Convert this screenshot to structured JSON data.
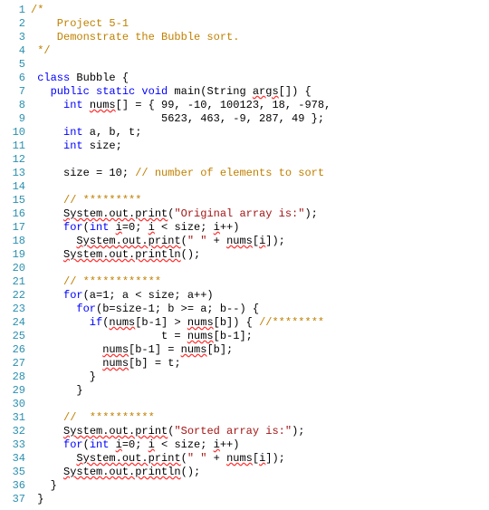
{
  "lines": [
    {
      "n": 1,
      "tokens": [
        [
          "c-orange",
          "/*",
          false
        ]
      ]
    },
    {
      "n": 2,
      "tokens": [
        [
          "c-orange",
          "    Project 5-1",
          false
        ]
      ]
    },
    {
      "n": 3,
      "tokens": [
        [
          "c-orange",
          "    Demonstrate the Bubble sort.",
          false
        ]
      ]
    },
    {
      "n": 4,
      "tokens": [
        [
          "c-orange",
          " */",
          false
        ]
      ]
    },
    {
      "n": 5,
      "tokens": [
        [
          "c-black",
          "",
          false
        ]
      ]
    },
    {
      "n": 6,
      "tokens": [
        [
          "c-blue",
          " class",
          false
        ],
        [
          "c-black",
          " Bubble {",
          false
        ]
      ]
    },
    {
      "n": 7,
      "tokens": [
        [
          "c-blue",
          "   public static void",
          false
        ],
        [
          "c-black",
          " main(String ",
          false
        ],
        [
          "c-black",
          "args",
          true
        ],
        [
          "c-black",
          "[]) {",
          false
        ]
      ]
    },
    {
      "n": 8,
      "tokens": [
        [
          "c-blue",
          "     int",
          false
        ],
        [
          "c-black",
          " ",
          false
        ],
        [
          "c-black",
          "nums",
          true
        ],
        [
          "c-black",
          "[] = { 99, -10, 100123, 18, -978,",
          false
        ]
      ]
    },
    {
      "n": 9,
      "tokens": [
        [
          "c-black",
          "                    5623, 463, -9, 287, 49 };",
          false
        ]
      ]
    },
    {
      "n": 10,
      "tokens": [
        [
          "c-blue",
          "     int",
          false
        ],
        [
          "c-black",
          " a, b, t;",
          false
        ]
      ]
    },
    {
      "n": 11,
      "tokens": [
        [
          "c-blue",
          "     int",
          false
        ],
        [
          "c-black",
          " size;",
          false
        ]
      ]
    },
    {
      "n": 12,
      "tokens": [
        [
          "c-black",
          "",
          false
        ]
      ]
    },
    {
      "n": 13,
      "tokens": [
        [
          "c-black",
          "     size = 10; ",
          false
        ],
        [
          "c-orange",
          "// number of elements to sort",
          false
        ]
      ]
    },
    {
      "n": 14,
      "tokens": [
        [
          "c-black",
          "",
          false
        ]
      ]
    },
    {
      "n": 15,
      "tokens": [
        [
          "c-black",
          "     ",
          false
        ],
        [
          "c-orange",
          "// *********",
          false
        ]
      ]
    },
    {
      "n": 16,
      "tokens": [
        [
          "c-black",
          "     ",
          false
        ],
        [
          "c-black",
          "System.out.print",
          true
        ],
        [
          "c-black",
          "(",
          false
        ],
        [
          "c-red",
          "\"Original array is:\"",
          false
        ],
        [
          "c-black",
          ");",
          false
        ]
      ]
    },
    {
      "n": 17,
      "tokens": [
        [
          "c-blue",
          "     for",
          false
        ],
        [
          "c-black",
          "(",
          false
        ],
        [
          "c-blue",
          "int",
          false
        ],
        [
          "c-black",
          " ",
          false
        ],
        [
          "c-black",
          "i",
          true
        ],
        [
          "c-black",
          "=0; ",
          false
        ],
        [
          "c-black",
          "i",
          true
        ],
        [
          "c-black",
          " < size; ",
          false
        ],
        [
          "c-black",
          "i",
          true
        ],
        [
          "c-black",
          "++)",
          false
        ]
      ]
    },
    {
      "n": 18,
      "tokens": [
        [
          "c-black",
          "       ",
          false
        ],
        [
          "c-black",
          "System.out.print",
          true
        ],
        [
          "c-black",
          "(",
          false
        ],
        [
          "c-red",
          "\" \"",
          false
        ],
        [
          "c-black",
          " + ",
          false
        ],
        [
          "c-black",
          "nums",
          true
        ],
        [
          "c-black",
          "[",
          false
        ],
        [
          "c-black",
          "i",
          true
        ],
        [
          "c-black",
          "]);",
          false
        ]
      ]
    },
    {
      "n": 19,
      "tokens": [
        [
          "c-black",
          "     ",
          false
        ],
        [
          "c-black",
          "System.out.println",
          true
        ],
        [
          "c-black",
          "();",
          false
        ]
      ]
    },
    {
      "n": 20,
      "tokens": [
        [
          "c-black",
          "",
          false
        ]
      ]
    },
    {
      "n": 21,
      "tokens": [
        [
          "c-black",
          "     ",
          false
        ],
        [
          "c-orange",
          "// ************",
          false
        ]
      ]
    },
    {
      "n": 22,
      "tokens": [
        [
          "c-blue",
          "     for",
          false
        ],
        [
          "c-black",
          "(a=1; a < size; a++)",
          false
        ]
      ]
    },
    {
      "n": 23,
      "tokens": [
        [
          "c-blue",
          "       for",
          false
        ],
        [
          "c-black",
          "(b=size-1; b >= a; b--) {",
          false
        ]
      ]
    },
    {
      "n": 24,
      "tokens": [
        [
          "c-blue",
          "         if",
          false
        ],
        [
          "c-black",
          "(",
          false
        ],
        [
          "c-black",
          "nums",
          true
        ],
        [
          "c-black",
          "[b-1] > ",
          false
        ],
        [
          "c-black",
          "nums",
          true
        ],
        [
          "c-black",
          "[b]) { ",
          false
        ],
        [
          "c-orange",
          "//********",
          false
        ]
      ]
    },
    {
      "n": 25,
      "tokens": [
        [
          "c-black",
          "                    t = ",
          false
        ],
        [
          "c-black",
          "nums",
          true
        ],
        [
          "c-black",
          "[b-1];",
          false
        ]
      ]
    },
    {
      "n": 26,
      "tokens": [
        [
          "c-black",
          "           ",
          false
        ],
        [
          "c-black",
          "nums",
          true
        ],
        [
          "c-black",
          "[b-1] = ",
          false
        ],
        [
          "c-black",
          "nums",
          true
        ],
        [
          "c-black",
          "[b];",
          false
        ]
      ]
    },
    {
      "n": 27,
      "tokens": [
        [
          "c-black",
          "           ",
          false
        ],
        [
          "c-black",
          "nums",
          true
        ],
        [
          "c-black",
          "[b] = t;",
          false
        ]
      ]
    },
    {
      "n": 28,
      "tokens": [
        [
          "c-black",
          "         }",
          false
        ]
      ]
    },
    {
      "n": 29,
      "tokens": [
        [
          "c-black",
          "       }",
          false
        ]
      ]
    },
    {
      "n": 30,
      "tokens": [
        [
          "c-black",
          "",
          false
        ]
      ]
    },
    {
      "n": 31,
      "tokens": [
        [
          "c-black",
          "     ",
          false
        ],
        [
          "c-orange",
          "//  **********",
          false
        ]
      ]
    },
    {
      "n": 32,
      "tokens": [
        [
          "c-black",
          "     ",
          false
        ],
        [
          "c-black",
          "System.out.print",
          true
        ],
        [
          "c-black",
          "(",
          false
        ],
        [
          "c-red",
          "\"Sorted array is:\"",
          false
        ],
        [
          "c-black",
          ");",
          false
        ]
      ]
    },
    {
      "n": 33,
      "tokens": [
        [
          "c-blue",
          "     for",
          false
        ],
        [
          "c-black",
          "(",
          false
        ],
        [
          "c-blue",
          "int",
          false
        ],
        [
          "c-black",
          " ",
          false
        ],
        [
          "c-black",
          "i",
          true
        ],
        [
          "c-black",
          "=0; ",
          false
        ],
        [
          "c-black",
          "i",
          true
        ],
        [
          "c-black",
          " < size; ",
          false
        ],
        [
          "c-black",
          "i",
          true
        ],
        [
          "c-black",
          "++)",
          false
        ]
      ]
    },
    {
      "n": 34,
      "tokens": [
        [
          "c-black",
          "       ",
          false
        ],
        [
          "c-black",
          "System.out.print",
          true
        ],
        [
          "c-black",
          "(",
          false
        ],
        [
          "c-red",
          "\" \"",
          false
        ],
        [
          "c-black",
          " + ",
          false
        ],
        [
          "c-black",
          "nums",
          true
        ],
        [
          "c-black",
          "[",
          false
        ],
        [
          "c-black",
          "i",
          true
        ],
        [
          "c-black",
          "]);",
          false
        ]
      ]
    },
    {
      "n": 35,
      "tokens": [
        [
          "c-black",
          "     ",
          false
        ],
        [
          "c-black",
          "System.out.println",
          true
        ],
        [
          "c-black",
          "();",
          false
        ]
      ]
    },
    {
      "n": 36,
      "tokens": [
        [
          "c-black",
          "   }",
          false
        ]
      ]
    },
    {
      "n": 37,
      "tokens": [
        [
          "c-black",
          " }",
          false
        ]
      ]
    }
  ]
}
